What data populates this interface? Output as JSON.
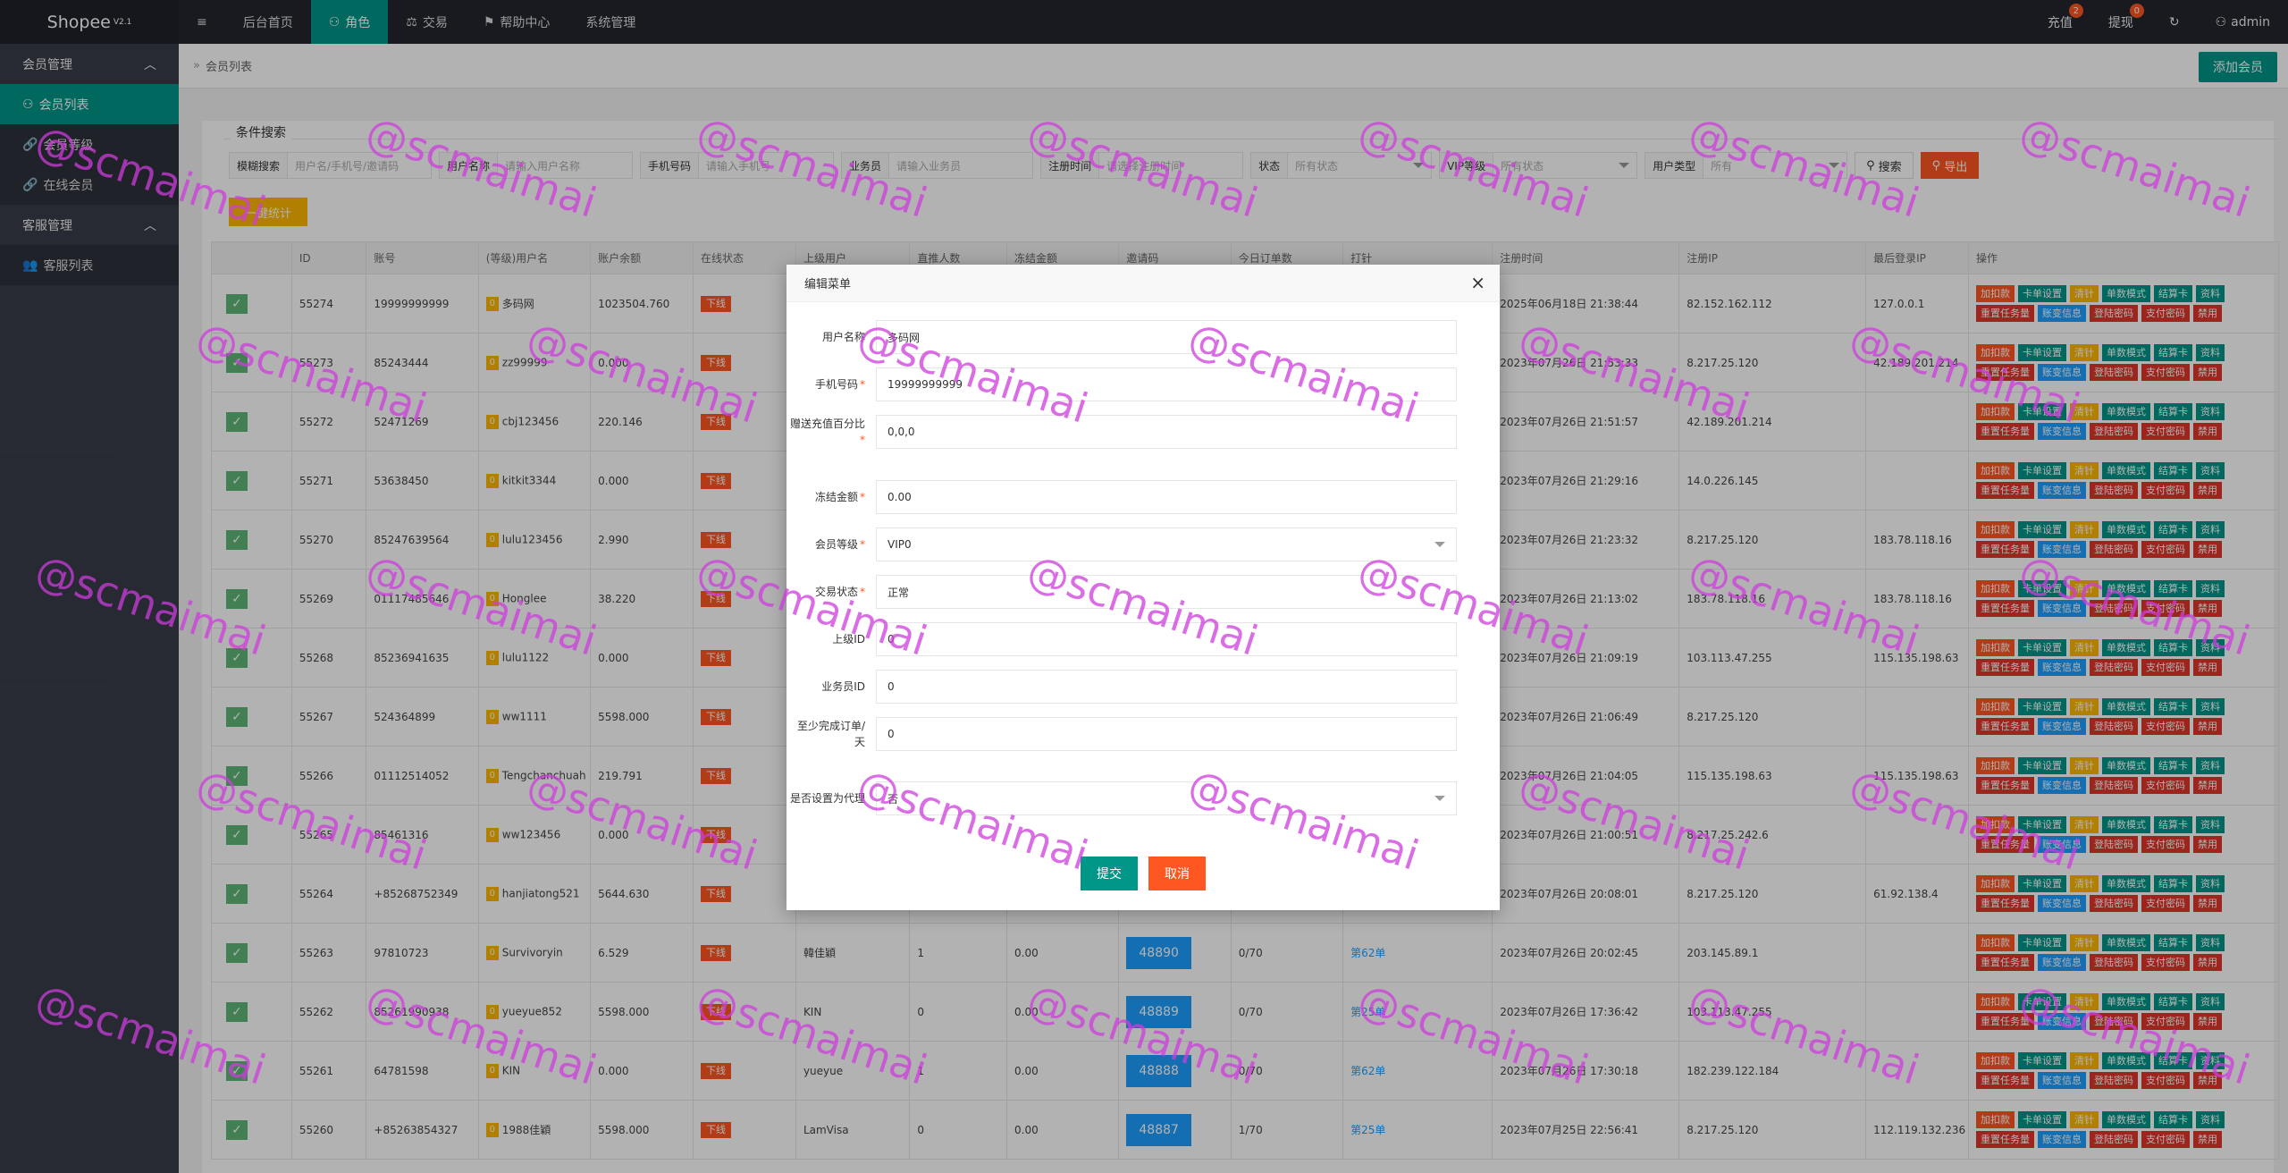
{
  "app": {
    "logo": "Shopee",
    "version": "V2.1"
  },
  "topnav": [
    {
      "label": "≡",
      "icon": "menu-icon"
    },
    {
      "label": "后台首页",
      "icon": ""
    },
    {
      "label": "角色",
      "icon": "user-icon"
    },
    {
      "label": "交易",
      "icon": "scale-icon"
    },
    {
      "label": "帮助中心",
      "icon": "flag-icon"
    },
    {
      "label": "系统管理",
      "icon": ""
    }
  ],
  "topright": {
    "recharge": "充值",
    "recharge_badge": "2",
    "withdraw": "提现",
    "withdraw_badge": "0",
    "refresh": "↻",
    "user": "admin"
  },
  "sidebar": {
    "group1": "会员管理",
    "items1": [
      "会员列表",
      "会员等级",
      "在线会员"
    ],
    "group2": "客服管理",
    "items2": [
      "客服列表"
    ]
  },
  "breadcrumb": "会员列表",
  "add_button": "添加会员",
  "search": {
    "legend": "条件搜索",
    "fields": [
      {
        "label": "模糊搜索",
        "placeholder": "用户名/手机号/邀请码"
      },
      {
        "label": "用户名称",
        "placeholder": "请输入用户名称"
      },
      {
        "label": "手机号码",
        "placeholder": "请输入手机号"
      },
      {
        "label": "业务员",
        "placeholder": "请输入业务员"
      },
      {
        "label": "注册时间",
        "placeholder": "请选择注册时间"
      },
      {
        "label": "状态",
        "placeholder": "所有状态"
      },
      {
        "label": "VIP等级",
        "placeholder": "所有状态"
      },
      {
        "label": "用户类型",
        "placeholder": "所有"
      }
    ],
    "search_btn": "搜索",
    "export_btn": "导出",
    "stat_btn": "一键统计"
  },
  "table": {
    "headers": [
      "",
      "ID",
      "账号",
      "(等级)用户名",
      "账户余额",
      "在线状态",
      "上级用户",
      "直推人数",
      "冻结金额",
      "邀请码",
      "今日订单数",
      "打针",
      "注册时间",
      "注册IP",
      "最后登录IP",
      "操作"
    ],
    "rows": [
      {
        "id": "55274",
        "account": "19999999999",
        "level": "0",
        "username": "多码网",
        "balance": "1023504.760",
        "status": "下线",
        "parent": "",
        "direct": "",
        "frozen": "",
        "code": "",
        "orders": "",
        "inject": "",
        "reg_time": "2025年06月18日 21:38:44",
        "reg_ip": "82.152.162.112",
        "last_ip": "127.0.0.1"
      },
      {
        "id": "55273",
        "account": "85243444",
        "level": "0",
        "username": "zz99999",
        "balance": "0.000",
        "status": "下线",
        "parent": "",
        "direct": "",
        "frozen": "",
        "code": "",
        "orders": "",
        "inject": "",
        "reg_time": "2023年07月26日 21:53:33",
        "reg_ip": "8.217.25.120",
        "last_ip": "42.189.201.214"
      },
      {
        "id": "55272",
        "account": "52471269",
        "level": "0",
        "username": "cbj123456",
        "balance": "220.146",
        "status": "下线",
        "parent": "",
        "direct": "",
        "frozen": "",
        "code": "",
        "orders": "",
        "inject": "",
        "reg_time": "2023年07月26日 21:51:57",
        "reg_ip": "42.189.201.214",
        "last_ip": ""
      },
      {
        "id": "55271",
        "account": "53638450",
        "level": "0",
        "username": "kitkit3344",
        "balance": "0.000",
        "status": "下线",
        "parent": "",
        "direct": "",
        "frozen": "",
        "code": "",
        "orders": "",
        "inject": "",
        "reg_time": "2023年07月26日 21:29:16",
        "reg_ip": "14.0.226.145",
        "last_ip": ""
      },
      {
        "id": "55270",
        "account": "85247639564",
        "level": "0",
        "username": "lulu123456",
        "balance": "2.990",
        "status": "下线",
        "parent": "",
        "direct": "",
        "frozen": "",
        "code": "",
        "orders": "",
        "inject": "",
        "reg_time": "2023年07月26日 21:23:32",
        "reg_ip": "8.217.25.120",
        "last_ip": "183.78.118.16"
      },
      {
        "id": "55269",
        "account": "01117485646",
        "level": "0",
        "username": "Honglee",
        "balance": "38.220",
        "status": "下线",
        "parent": "",
        "direct": "",
        "frozen": "",
        "code": "",
        "orders": "",
        "inject": "",
        "reg_time": "2023年07月26日 21:13:02",
        "reg_ip": "183.78.118.16",
        "last_ip": "183.78.118.16"
      },
      {
        "id": "55268",
        "account": "85236941635",
        "level": "0",
        "username": "lulu1122",
        "balance": "0.000",
        "status": "下线",
        "parent": "",
        "direct": "",
        "frozen": "",
        "code": "",
        "orders": "",
        "inject": "",
        "reg_time": "2023年07月26日 21:09:19",
        "reg_ip": "103.113.47.255",
        "last_ip": "115.135.198.63"
      },
      {
        "id": "55267",
        "account": "524364899",
        "level": "0",
        "username": "ww1111",
        "balance": "5598.000",
        "status": "下线",
        "parent": "",
        "direct": "",
        "frozen": "",
        "code": "",
        "orders": "",
        "inject": "",
        "reg_time": "2023年07月26日 21:06:49",
        "reg_ip": "8.217.25.120",
        "last_ip": ""
      },
      {
        "id": "55266",
        "account": "01112514052",
        "level": "0",
        "username": "Tengchanchuah",
        "balance": "219.791",
        "status": "下线",
        "parent": "",
        "direct": "",
        "frozen": "",
        "code": "",
        "orders": "",
        "inject": "",
        "reg_time": "2023年07月26日 21:04:05",
        "reg_ip": "115.135.198.63",
        "last_ip": "115.135.198.63"
      },
      {
        "id": "55265",
        "account": "85461316",
        "level": "0",
        "username": "ww123456",
        "balance": "0.000",
        "status": "下线",
        "parent": "",
        "direct": "",
        "frozen": "",
        "code": "",
        "orders": "",
        "inject": "",
        "reg_time": "2023年07月26日 21:00:51",
        "reg_ip": "8.217.25.242.6",
        "last_ip": ""
      },
      {
        "id": "55264",
        "account": "+85268752349",
        "level": "0",
        "username": "hanjiatong521",
        "balance": "5644.630",
        "status": "下线",
        "parent": "",
        "direct": "",
        "frozen": "",
        "code": "",
        "orders": "",
        "inject": "",
        "reg_time": "2023年07月26日 20:08:01",
        "reg_ip": "8.217.25.120",
        "last_ip": "61.92.138.4"
      },
      {
        "id": "55263",
        "account": "97810723",
        "level": "0",
        "username": "Survivoryin",
        "balance": "6.529",
        "status": "下线",
        "parent": "韓佳穎",
        "direct": "1",
        "frozen": "0.00",
        "code": "48890",
        "orders": "0/70",
        "inject": "第62单",
        "reg_time": "2023年07月26日 20:02:45",
        "reg_ip": "203.145.89.1",
        "last_ip": ""
      },
      {
        "id": "55262",
        "account": "85261990938",
        "level": "0",
        "username": "yueyue852",
        "balance": "5598.000",
        "status": "下线",
        "parent": "KIN",
        "direct": "0",
        "frozen": "0.00",
        "code": "48889",
        "orders": "0/70",
        "inject": "第25单",
        "reg_time": "2023年07月26日 17:36:42",
        "reg_ip": "103.113.47.255",
        "last_ip": ""
      },
      {
        "id": "55261",
        "account": "64781598",
        "level": "0",
        "username": "KIN",
        "balance": "0.000",
        "status": "下线",
        "parent": "yueyue",
        "direct": "1",
        "frozen": "0.00",
        "code": "48888",
        "orders": "0/70",
        "inject": "第62单",
        "reg_time": "2023年07月26日 17:30:18",
        "reg_ip": "182.239.122.184",
        "last_ip": ""
      },
      {
        "id": "55260",
        "account": "+85263854327",
        "level": "0",
        "username": "1988佳穎",
        "balance": "5598.000",
        "status": "下线",
        "parent": "LamVisa",
        "direct": "0",
        "frozen": "0.00",
        "code": "48887",
        "orders": "1/70",
        "inject": "第25单",
        "reg_time": "2023年07月25日 22:56:41",
        "reg_ip": "8.217.25.120",
        "last_ip": "112.119.132.236"
      }
    ],
    "ops_row1": [
      "加扣款",
      "卡单设置",
      "清针",
      "单数模式",
      "结算卡",
      "资料"
    ],
    "ops_row2": [
      "重置任务量",
      "账变信息",
      "登陆密码",
      "支付密码",
      "禁用"
    ]
  },
  "modal": {
    "title": "编辑菜单",
    "fields": [
      {
        "label": "用户名称",
        "value": "多码网",
        "required": false
      },
      {
        "label": "手机号码",
        "value": "19999999999",
        "required": true
      },
      {
        "label": "赠送充值百分比",
        "value": "0,0,0",
        "required": true
      },
      {
        "label": "冻结金额",
        "value": "0.00",
        "required": true
      },
      {
        "label": "会员等级",
        "value": "VIP0",
        "required": true
      },
      {
        "label": "交易状态",
        "value": "正常",
        "required": true
      },
      {
        "label": "上级ID",
        "value": "0",
        "required": false
      },
      {
        "label": "业务员ID",
        "value": "0",
        "required": false
      },
      {
        "label": "至少完成订单/天",
        "value": "0",
        "required": false
      },
      {
        "label": "是否设置为代理",
        "value": "否",
        "required": false
      }
    ],
    "submit": "提交",
    "cancel": "取消"
  },
  "watermark": "@scmaimai",
  "colors": {
    "accent": "#009688",
    "danger": "#ff5722",
    "warn": "#ffb800",
    "info": "#1e9fff",
    "watermark": "#cd3cdc"
  }
}
